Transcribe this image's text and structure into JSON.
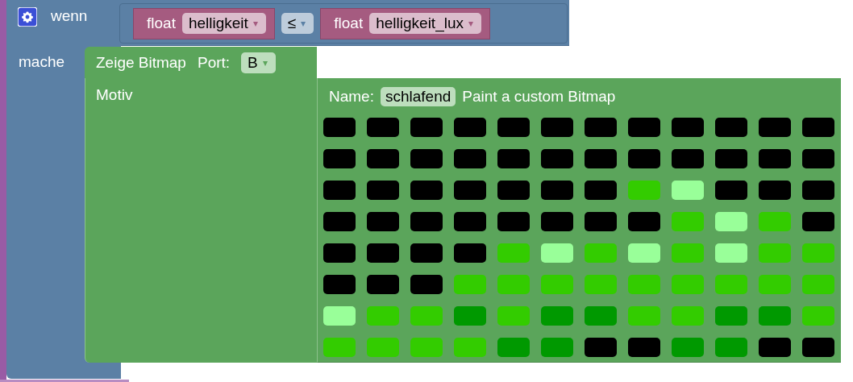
{
  "if_block": {
    "label": "wenn",
    "do_label": "mache",
    "condition": {
      "left": {
        "type_label": "float",
        "variable": "helligkeit",
        "arrow": "▾"
      },
      "operator": {
        "symbol": "≤",
        "arrow": "▾"
      },
      "right": {
        "type_label": "float",
        "variable": "helligkeit_lux",
        "arrow": "▾"
      }
    }
  },
  "bitmap_display": {
    "title": "Zeige Bitmap",
    "port_label": "Port:",
    "port": "B",
    "port_arrow": "▾",
    "motif_label": "Motiv"
  },
  "bitmap": {
    "name_label": "Name:",
    "name": "schlafend",
    "caption": "Paint a custom Bitmap",
    "rows": [
      {
        "cells": [
          {
            "color": "#000000"
          },
          {
            "color": "#000000"
          },
          {
            "color": "#000000"
          },
          {
            "color": "#000000"
          },
          {
            "color": "#000000"
          },
          {
            "color": "#000000"
          },
          {
            "color": "#000000"
          },
          {
            "color": "#000000"
          },
          {
            "color": "#000000"
          },
          {
            "color": "#000000"
          },
          {
            "color": "#000000"
          },
          {
            "color": "#000000"
          }
        ]
      },
      {
        "cells": [
          {
            "color": "#000000"
          },
          {
            "color": "#000000"
          },
          {
            "color": "#000000"
          },
          {
            "color": "#000000"
          },
          {
            "color": "#000000"
          },
          {
            "color": "#000000"
          },
          {
            "color": "#000000"
          },
          {
            "color": "#000000"
          },
          {
            "color": "#000000"
          },
          {
            "color": "#000000"
          },
          {
            "color": "#000000"
          },
          {
            "color": "#000000"
          }
        ]
      },
      {
        "cells": [
          {
            "color": "#000000"
          },
          {
            "color": "#000000"
          },
          {
            "color": "#000000"
          },
          {
            "color": "#000000"
          },
          {
            "color": "#000000"
          },
          {
            "color": "#000000"
          },
          {
            "color": "#000000"
          },
          {
            "color": "#33cc00"
          },
          {
            "color": "#99ff99"
          },
          {
            "color": "#000000"
          },
          {
            "color": "#000000"
          },
          {
            "color": "#000000"
          }
        ]
      },
      {
        "cells": [
          {
            "color": "#000000"
          },
          {
            "color": "#000000"
          },
          {
            "color": "#000000"
          },
          {
            "color": "#000000"
          },
          {
            "color": "#000000"
          },
          {
            "color": "#000000"
          },
          {
            "color": "#000000"
          },
          {
            "color": "#000000"
          },
          {
            "color": "#33cc00"
          },
          {
            "color": "#99ff99"
          },
          {
            "color": "#33cc00"
          },
          {
            "color": "#000000"
          }
        ]
      },
      {
        "cells": [
          {
            "color": "#000000"
          },
          {
            "color": "#000000"
          },
          {
            "color": "#000000"
          },
          {
            "color": "#000000"
          },
          {
            "color": "#33cc00"
          },
          {
            "color": "#99ff99"
          },
          {
            "color": "#33cc00"
          },
          {
            "color": "#99ff99"
          },
          {
            "color": "#33cc00"
          },
          {
            "color": "#99ff99"
          },
          {
            "color": "#33cc00"
          },
          {
            "color": "#33cc00"
          }
        ]
      },
      {
        "cells": [
          {
            "color": "#000000"
          },
          {
            "color": "#000000"
          },
          {
            "color": "#000000"
          },
          {
            "color": "#33cc00"
          },
          {
            "color": "#33cc00"
          },
          {
            "color": "#33cc00"
          },
          {
            "color": "#33cc00"
          },
          {
            "color": "#33cc00"
          },
          {
            "color": "#33cc00"
          },
          {
            "color": "#33cc00"
          },
          {
            "color": "#33cc00"
          },
          {
            "color": "#33cc00"
          }
        ]
      },
      {
        "cells": [
          {
            "color": "#99ff99"
          },
          {
            "color": "#33cc00"
          },
          {
            "color": "#33cc00"
          },
          {
            "color": "#009900"
          },
          {
            "color": "#33cc00"
          },
          {
            "color": "#009900"
          },
          {
            "color": "#009900"
          },
          {
            "color": "#33cc00"
          },
          {
            "color": "#33cc00"
          },
          {
            "color": "#009900"
          },
          {
            "color": "#009900"
          },
          {
            "color": "#33cc00"
          }
        ]
      },
      {
        "cells": [
          {
            "color": "#33cc00"
          },
          {
            "color": "#33cc00"
          },
          {
            "color": "#33cc00"
          },
          {
            "color": "#33cc00"
          },
          {
            "color": "#009900"
          },
          {
            "color": "#009900"
          },
          {
            "color": "#000000"
          },
          {
            "color": "#000000"
          },
          {
            "color": "#009900"
          },
          {
            "color": "#009900"
          },
          {
            "color": "#000000"
          },
          {
            "color": "#000000"
          }
        ]
      }
    ]
  }
}
